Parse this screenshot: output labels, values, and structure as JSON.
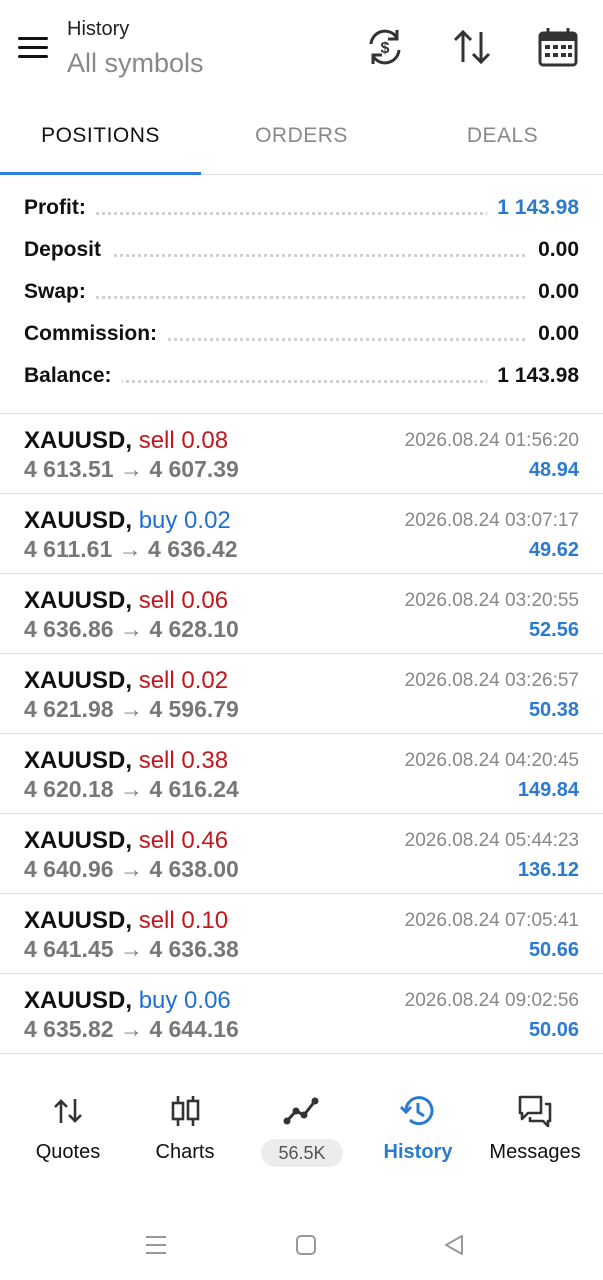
{
  "header": {
    "title": "History",
    "subtitle": "All symbols"
  },
  "tabs": [
    {
      "label": "POSITIONS",
      "active": true
    },
    {
      "label": "ORDERS",
      "active": false
    },
    {
      "label": "DEALS",
      "active": false
    }
  ],
  "summary": [
    {
      "label": "Profit:",
      "value": "1 143.98",
      "color": "#2b7ad0"
    },
    {
      "label": "Deposit",
      "value": "0.00"
    },
    {
      "label": "Swap:",
      "value": "0.00"
    },
    {
      "label": "Commission:",
      "value": "0.00"
    },
    {
      "label": "Balance:",
      "value": "1 143.98"
    }
  ],
  "deals": [
    {
      "symbol": "XAUUSD,",
      "side": "sell 0.08",
      "type": "sell",
      "open": "4 613.51",
      "close": "4 607.39",
      "time": "2026.08.24 01:56:20",
      "profit": "48.94"
    },
    {
      "symbol": "XAUUSD,",
      "side": "buy 0.02",
      "type": "buy",
      "open": "4 611.61",
      "close": "4 636.42",
      "time": "2026.08.24 03:07:17",
      "profit": "49.62"
    },
    {
      "symbol": "XAUUSD,",
      "side": "sell 0.06",
      "type": "sell",
      "open": "4 636.86",
      "close": "4 628.10",
      "time": "2026.08.24 03:20:55",
      "profit": "52.56"
    },
    {
      "symbol": "XAUUSD,",
      "side": "sell 0.02",
      "type": "sell",
      "open": "4 621.98",
      "close": "4 596.79",
      "time": "2026.08.24 03:26:57",
      "profit": "50.38"
    },
    {
      "symbol": "XAUUSD,",
      "side": "sell 0.38",
      "type": "sell",
      "open": "4 620.18",
      "close": "4 616.24",
      "time": "2026.08.24 04:20:45",
      "profit": "149.84"
    },
    {
      "symbol": "XAUUSD,",
      "side": "sell 0.46",
      "type": "sell",
      "open": "4 640.96",
      "close": "4 638.00",
      "time": "2026.08.24 05:44:23",
      "profit": "136.12"
    },
    {
      "symbol": "XAUUSD,",
      "side": "sell 0.10",
      "type": "sell",
      "open": "4 641.45",
      "close": "4 636.38",
      "time": "2026.08.24 07:05:41",
      "profit": "50.66"
    },
    {
      "symbol": "XAUUSD,",
      "side": "buy 0.06",
      "type": "buy",
      "open": "4 635.82",
      "close": "4 644.16",
      "time": "2026.08.24 09:02:56",
      "profit": "50.06"
    }
  ],
  "arrow": "→",
  "nav": [
    {
      "label": "Quotes",
      "icon": "quotes-icon"
    },
    {
      "label": "Charts",
      "icon": "charts-icon"
    },
    {
      "label": "56.5K",
      "icon": "signals-icon",
      "badge": true
    },
    {
      "label": "History",
      "icon": "history-icon",
      "active": true
    },
    {
      "label": "Messages",
      "icon": "messages-icon"
    }
  ],
  "colors": {
    "accent": "#2b7ad0",
    "sell": "#c4161c",
    "buy": "#1f6fd0"
  }
}
